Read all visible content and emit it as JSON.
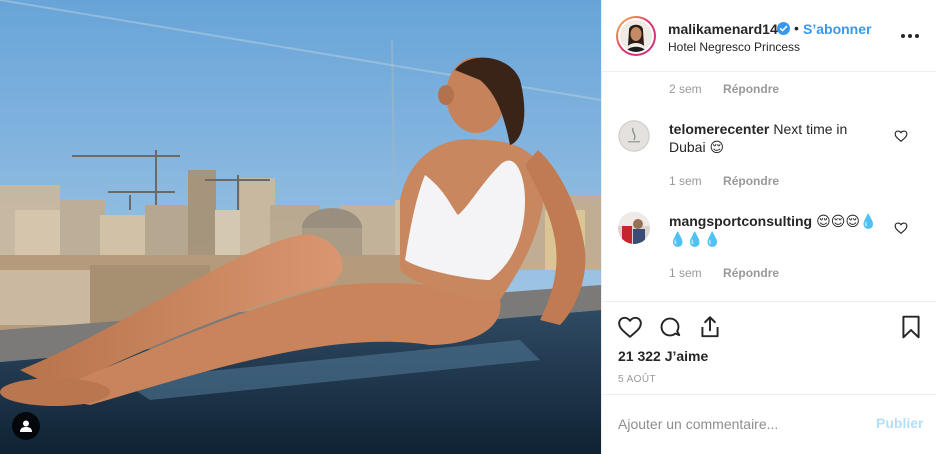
{
  "post": {
    "username": "malikamenard14",
    "verified": true,
    "separator": "•",
    "follow_label": "S’abonner",
    "location": "Hotel Negresco Princess",
    "more_icon": "more-horizontal-icon"
  },
  "comments": [
    {
      "partial": true,
      "time": "2 sem",
      "reply_label": "Répondre"
    },
    {
      "username": "telomerecenter",
      "text": "Next time in Dubai 😌",
      "time": "1 sem",
      "reply_label": "Répondre"
    },
    {
      "username": "mangsportconsulting",
      "text": "😌😌😌💧💧💧💧",
      "time": "1 sem",
      "reply_label": "Répondre"
    }
  ],
  "actions": {
    "icons": [
      "heart-icon",
      "comment-icon",
      "share-icon",
      "bookmark-icon"
    ],
    "likes": "21 322 J’aime",
    "date": "5 AOÛT"
  },
  "add_comment": {
    "placeholder": "Ajouter un commentaire...",
    "publish_label": "Publier"
  },
  "colors": {
    "link_blue": "#3897f0",
    "publish_disabled": "#b2dffc",
    "muted": "#999999",
    "text": "#262626",
    "border": "#efefef"
  }
}
